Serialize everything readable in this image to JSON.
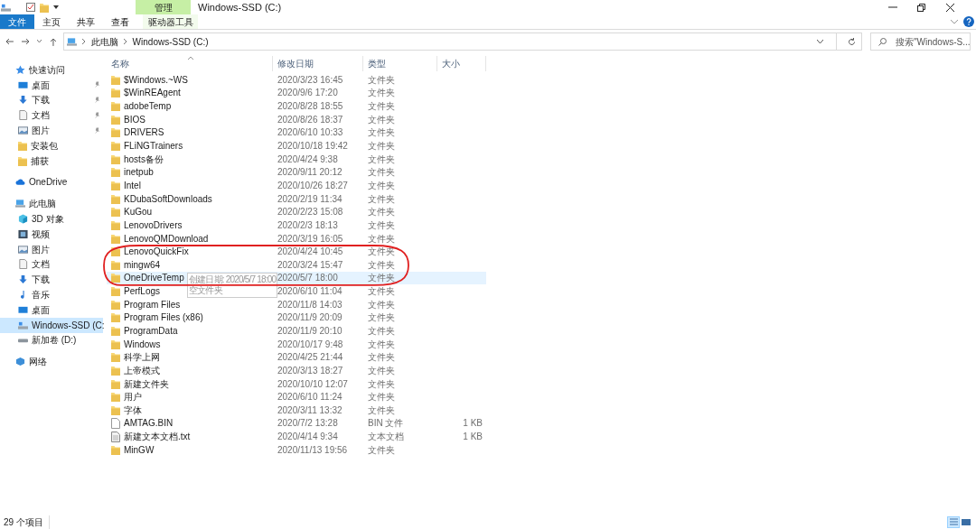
{
  "window": {
    "title": "Windows-SSD (C:)",
    "context_group": "管理"
  },
  "ribbon_tabs": [
    {
      "label": "文件",
      "kind": "file"
    },
    {
      "label": "主页",
      "kind": "tab"
    },
    {
      "label": "共享",
      "kind": "tab"
    },
    {
      "label": "查看",
      "kind": "tab"
    },
    {
      "label": "驱动器工具",
      "kind": "context"
    }
  ],
  "address": {
    "crumbs": [
      "此电脑",
      "Windows-SSD (C:)"
    ]
  },
  "search": {
    "placeholder": "搜索\"Windows-S..."
  },
  "sidebar": [
    {
      "label": "快速访问",
      "kind": "star",
      "selected": false,
      "children": [
        {
          "label": "桌面",
          "kind": "desktop",
          "selected": false,
          "pinned": true
        },
        {
          "label": "下载",
          "kind": "download",
          "selected": false,
          "pinned": true
        },
        {
          "label": "文档",
          "kind": "document",
          "selected": false,
          "pinned": true
        },
        {
          "label": "图片",
          "kind": "picture",
          "selected": false,
          "pinned": true
        },
        {
          "label": "安装包",
          "kind": "folder",
          "selected": false,
          "pinned": false
        },
        {
          "label": "捕获",
          "kind": "folder",
          "selected": false,
          "pinned": false
        }
      ]
    },
    {
      "label": "OneDrive",
      "kind": "cloud",
      "selected": false
    },
    {
      "label": "此电脑",
      "kind": "pc",
      "selected": false,
      "children": [
        {
          "label": "3D 对象",
          "kind": "cube",
          "selected": false,
          "pinned": false
        },
        {
          "label": "视频",
          "kind": "video",
          "selected": false,
          "pinned": false
        },
        {
          "label": "图片",
          "kind": "picture",
          "selected": false,
          "pinned": false
        },
        {
          "label": "文档",
          "kind": "document",
          "selected": false,
          "pinned": false
        },
        {
          "label": "下载",
          "kind": "download",
          "selected": false,
          "pinned": false
        },
        {
          "label": "音乐",
          "kind": "music",
          "selected": false,
          "pinned": false
        },
        {
          "label": "桌面",
          "kind": "desktop",
          "selected": false,
          "pinned": false
        },
        {
          "label": "Windows-SSD (C:",
          "kind": "drive",
          "selected": true,
          "pinned": false
        },
        {
          "label": "新加卷 (D:)",
          "kind": "disk",
          "selected": false,
          "pinned": false
        }
      ]
    },
    {
      "label": "网络",
      "kind": "network",
      "selected": false
    }
  ],
  "table": {
    "columns": [
      "名称",
      "修改日期",
      "类型",
      "大小"
    ],
    "rows": [
      {
        "name": "$Windows.~WS",
        "date": "2020/3/23 16:45",
        "type": "文件夹",
        "kind": "folder",
        "hovered": false
      },
      {
        "name": "$WinREAgent",
        "date": "2020/9/6 17:20",
        "type": "文件夹",
        "kind": "folder",
        "hovered": false
      },
      {
        "name": "adobeTemp",
        "date": "2020/8/28 18:55",
        "type": "文件夹",
        "kind": "folder",
        "hovered": false
      },
      {
        "name": "BIOS",
        "date": "2020/8/26 18:37",
        "type": "文件夹",
        "kind": "folder",
        "hovered": false
      },
      {
        "name": "DRIVERS",
        "date": "2020/6/10 10:33",
        "type": "文件夹",
        "kind": "folder",
        "hovered": false
      },
      {
        "name": "FLiNGTrainers",
        "date": "2020/10/18 19:42",
        "type": "文件夹",
        "kind": "folder",
        "hovered": false
      },
      {
        "name": "hosts备份",
        "date": "2020/4/24 9:38",
        "type": "文件夹",
        "kind": "folder",
        "hovered": false
      },
      {
        "name": "inetpub",
        "date": "2020/9/11 20:12",
        "type": "文件夹",
        "kind": "folder",
        "hovered": false
      },
      {
        "name": "Intel",
        "date": "2020/10/26 18:27",
        "type": "文件夹",
        "kind": "folder",
        "hovered": false
      },
      {
        "name": "KDubaSoftDownloads",
        "date": "2020/2/19 11:34",
        "type": "文件夹",
        "kind": "folder",
        "hovered": false
      },
      {
        "name": "KuGou",
        "date": "2020/2/23 15:08",
        "type": "文件夹",
        "kind": "folder",
        "hovered": false
      },
      {
        "name": "LenovoDrivers",
        "date": "2020/2/3 18:13",
        "type": "文件夹",
        "kind": "folder",
        "hovered": false
      },
      {
        "name": "LenovoQMDownload",
        "date": "2020/3/19 16:05",
        "type": "文件夹",
        "kind": "folder",
        "hovered": false
      },
      {
        "name": "LenovoQuickFix",
        "date": "2020/4/24 10:45",
        "type": "文件夹",
        "kind": "folder",
        "hovered": false
      },
      {
        "name": "mingw64",
        "date": "2020/3/24 15:47",
        "type": "文件夹",
        "kind": "folder",
        "hovered": false
      },
      {
        "name": "OneDriveTemp",
        "date": "2020/5/7 18:00",
        "type": "文件夹",
        "kind": "folder",
        "hovered": true
      },
      {
        "name": "PerfLogs",
        "date": "2020/6/10 11:04",
        "type": "文件夹",
        "kind": "folder",
        "hovered": false
      },
      {
        "name": "Program Files",
        "date": "2020/11/8 14:03",
        "type": "文件夹",
        "kind": "folder",
        "hovered": false
      },
      {
        "name": "Program Files (x86)",
        "date": "2020/11/9 20:09",
        "type": "文件夹",
        "kind": "folder",
        "hovered": false
      },
      {
        "name": "ProgramData",
        "date": "2020/11/9 20:10",
        "type": "文件夹",
        "kind": "folder",
        "hovered": false
      },
      {
        "name": "Windows",
        "date": "2020/10/17 9:48",
        "type": "文件夹",
        "kind": "folder",
        "hovered": false
      },
      {
        "name": "科学上网",
        "date": "2020/4/25 21:44",
        "type": "文件夹",
        "kind": "folder",
        "hovered": false
      },
      {
        "name": "上帝模式",
        "date": "2020/3/13 18:27",
        "type": "文件夹",
        "kind": "folder",
        "hovered": false
      },
      {
        "name": "新建文件夹",
        "date": "2020/10/10 12:07",
        "type": "文件夹",
        "kind": "folder",
        "hovered": false
      },
      {
        "name": "用户",
        "date": "2020/6/10 11:24",
        "type": "文件夹",
        "kind": "folder",
        "hovered": false
      },
      {
        "name": "字体",
        "date": "2020/3/11 13:32",
        "type": "文件夹",
        "kind": "folder",
        "hovered": false
      },
      {
        "name": "AMTAG.BIN",
        "date": "2020/7/2 13:28",
        "type": "BIN 文件",
        "size": "1 KB",
        "kind": "file",
        "hovered": false
      },
      {
        "name": "新建文本文档.txt",
        "date": "2020/4/14 9:34",
        "type": "文本文档",
        "size": "1 KB",
        "kind": "text",
        "hovered": false
      },
      {
        "name": "MinGW",
        "date": "2020/11/13 19:56",
        "type": "文件夹",
        "kind": "folder",
        "hovered": false
      }
    ]
  },
  "tooltip": {
    "lines": [
      "创建日期: 2020/5/7 18:00",
      "空文件夹"
    ]
  },
  "status_bar": {
    "count": "29 个项目",
    "views": [
      {
        "kind": "details",
        "selected": true
      },
      {
        "kind": "thumbnails",
        "selected": false
      }
    ]
  }
}
